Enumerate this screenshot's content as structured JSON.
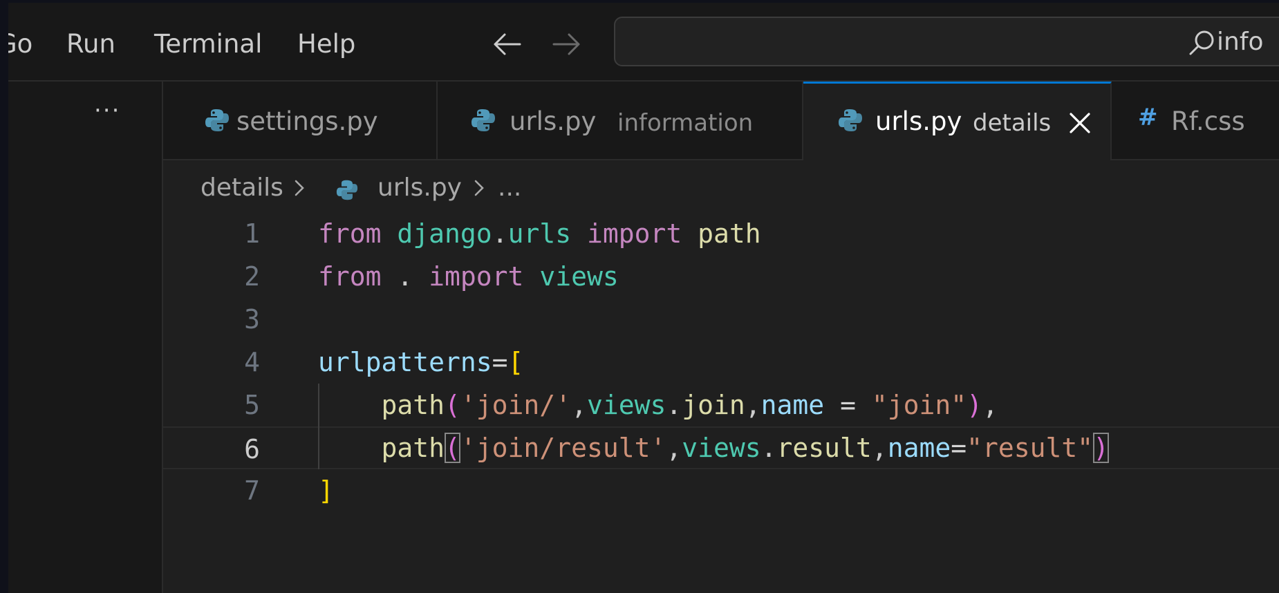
{
  "menu": {
    "go": "Go",
    "run": "Run",
    "terminal": "Terminal",
    "help": "Help"
  },
  "command_center": {
    "text": "info"
  },
  "sidebar": {
    "more": "···"
  },
  "tabs": [
    {
      "label": "settings.py",
      "description": "",
      "icon": "python-icon"
    },
    {
      "label": "urls.py",
      "description": "information",
      "icon": "python-icon"
    },
    {
      "label": "urls.py",
      "description": "details",
      "icon": "python-icon",
      "active": true
    },
    {
      "label": "Rf.css",
      "description": "",
      "icon": "css-hash-icon"
    }
  ],
  "breadcrumb": {
    "folder": "details",
    "file": "urls.py",
    "ellipsis": "..."
  },
  "editor": {
    "current_line": 6,
    "lines": [
      {
        "number": "1",
        "text": "from django.urls import path"
      },
      {
        "number": "2",
        "text": "from . import views"
      },
      {
        "number": "3",
        "text": ""
      },
      {
        "number": "4",
        "text": "urlpatterns=["
      },
      {
        "number": "5",
        "text": "    path('join/',views.join,name = \"join\"),"
      },
      {
        "number": "6",
        "text": "    path('join/result',views.result,name=\"result\")"
      },
      {
        "number": "7",
        "text": "]"
      }
    ]
  },
  "colors": {
    "keyword": "#c586c0",
    "module": "#4ec9b0",
    "function": "#dcdcaa",
    "variable": "#9cdcfe",
    "string": "#ce9178",
    "bracket_level1": "#ffd700",
    "bracket_level2": "#da70d6",
    "accent": "#0078d4"
  }
}
